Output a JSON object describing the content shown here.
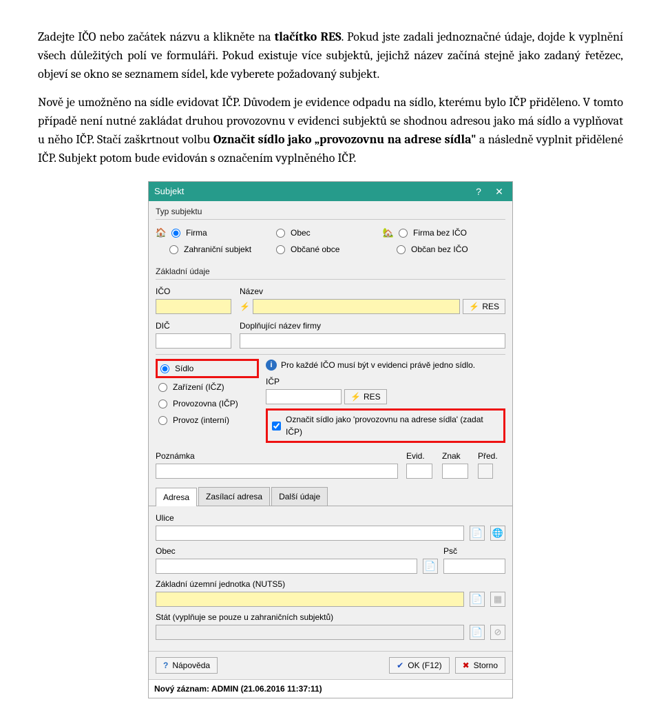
{
  "doc": {
    "p1a": "Zadejte IČO nebo začátek názvu a klikněte na ",
    "p1b": "tlačítko RES",
    "p1c": ". Pokud jste zadali jednoznačné údaje, dojde k vyplnění všech důležitých polí ve formuláři. Pokud existuje více subjektů, jejichž název začíná stejně jako zadaný řetězec, objeví se okno se seznamem sídel, kde vyberete požadovaný subjekt.",
    "p2a": "Nově je umožněno na sídle evidovat IČP. Důvodem je evidence odpadu na sídlo, kterému bylo IČP přiděleno. V tomto případě není nutné zakládat druhou provozovnu v evidenci subjektů se shodnou adresou jako má sídlo a vyplňovat u něho IČP. Stačí zaškrtnout volbu ",
    "p2b": "Označit sídlo jako „provozovnu na adrese sídla\"",
    "p2c": " a následně vyplnit přidělené IČP. Subjekt potom bude evidován s označením vyplněného IČP."
  },
  "win": {
    "title": "Subjekt",
    "sections": {
      "type": "Typ subjektu",
      "basic": "Základní údaje"
    },
    "type_radios": {
      "firma": "Firma",
      "obec": "Obec",
      "firma_bez": "Firma bez IČO",
      "zahranicni": "Zahraniční subjekt",
      "obcane": "Občané obce",
      "obcan_bez": "Občan bez IČO"
    },
    "labels": {
      "ico": "IČO",
      "nazev": "Název",
      "res": "RES",
      "dic": "DIČ",
      "dopln": "Doplňující název firmy",
      "sidlo": "Sídlo",
      "zarizeni": "Zařízení (IČZ)",
      "provozovna": "Provozovna (IČP)",
      "provoz": "Provoz (interní)",
      "icp": "IČP",
      "info": "Pro každé IČO musí být v evidenci právě jedno sídlo.",
      "checkbox": "Označit sídlo jako 'provozovnu na adrese sídla' (zadat IČP)",
      "poznamka": "Poznámka",
      "evid": "Evid.",
      "znak": "Znak",
      "pred": "Před."
    },
    "tabs": {
      "adresa": "Adresa",
      "zasilaci": "Zasílací adresa",
      "dalsi": "Další údaje"
    },
    "addr": {
      "ulice": "Ulice",
      "obec": "Obec",
      "psc": "Psč",
      "nuts": "Základní územní jednotka (NUTS5)",
      "stat": "Stát (vyplňuje se pouze u zahraničních subjektů)"
    },
    "footer": {
      "help": "Nápověda",
      "ok": "OK (F12)",
      "storno": "Storno"
    },
    "status": "Nový záznam: ADMIN (21.06.2016 11:37:11)"
  }
}
